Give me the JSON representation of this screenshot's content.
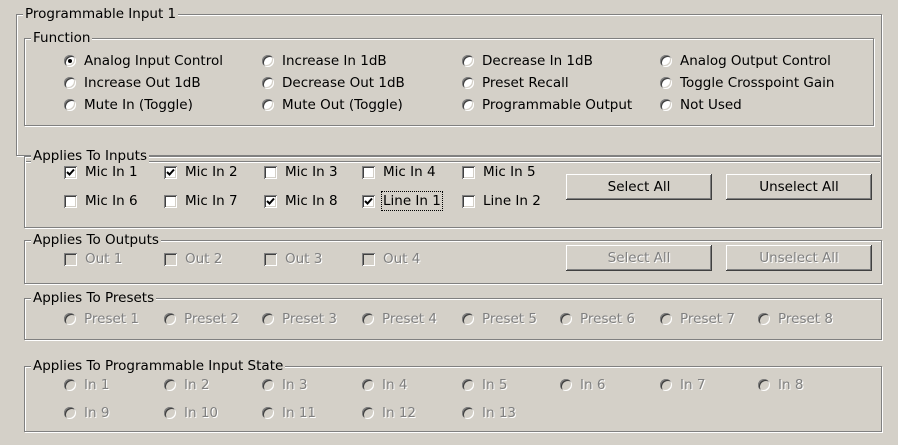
{
  "outer_title": "Programmable Input 1",
  "function": {
    "title": "Function",
    "options": [
      {
        "label": "Analog Input Control",
        "selected": true
      },
      {
        "label": "Increase In 1dB",
        "selected": false
      },
      {
        "label": "Decrease In 1dB",
        "selected": false
      },
      {
        "label": "Analog Output Control",
        "selected": false
      },
      {
        "label": "Increase Out 1dB",
        "selected": false
      },
      {
        "label": "Decrease Out 1dB",
        "selected": false
      },
      {
        "label": "Preset Recall",
        "selected": false
      },
      {
        "label": "Toggle Crosspoint Gain",
        "selected": false
      },
      {
        "label": "Mute In (Toggle)",
        "selected": false
      },
      {
        "label": "Mute Out (Toggle)",
        "selected": false
      },
      {
        "label": "Programmable Output",
        "selected": false
      },
      {
        "label": "Not Used",
        "selected": false
      }
    ]
  },
  "inputs": {
    "title": "Applies To Inputs",
    "items": [
      {
        "label": "Mic In 1",
        "checked": true
      },
      {
        "label": "Mic In 2",
        "checked": true
      },
      {
        "label": "Mic In 3",
        "checked": false
      },
      {
        "label": "Mic In 4",
        "checked": false
      },
      {
        "label": "Mic In 5",
        "checked": false
      },
      {
        "label": "Mic In 6",
        "checked": false
      },
      {
        "label": "Mic In 7",
        "checked": false
      },
      {
        "label": "Mic In 8",
        "checked": true
      },
      {
        "label": "Line In 1",
        "checked": true,
        "focused": true
      },
      {
        "label": "Line In 2",
        "checked": false
      }
    ],
    "select_all": "Select All",
    "unselect_all": "Unselect All"
  },
  "outputs": {
    "title": "Applies To Outputs",
    "items": [
      {
        "label": "Out 1",
        "checked": false
      },
      {
        "label": "Out 2",
        "checked": false
      },
      {
        "label": "Out 3",
        "checked": false
      },
      {
        "label": "Out 4",
        "checked": false
      }
    ],
    "select_all": "Select All",
    "unselect_all": "Unselect All",
    "disabled": true
  },
  "presets": {
    "title": "Applies To Presets",
    "items": [
      "Preset 1",
      "Preset 2",
      "Preset 3",
      "Preset 4",
      "Preset 5",
      "Preset 6",
      "Preset 7",
      "Preset 8"
    ],
    "disabled": true
  },
  "prog_state": {
    "title": "Applies To Programmable Input State",
    "items": [
      "In 1",
      "In 2",
      "In 3",
      "In 4",
      "In 5",
      "In 6",
      "In 7",
      "In 8",
      "In 9",
      "In 10",
      "In 11",
      "In 12",
      "In 13"
    ],
    "disabled": true
  }
}
